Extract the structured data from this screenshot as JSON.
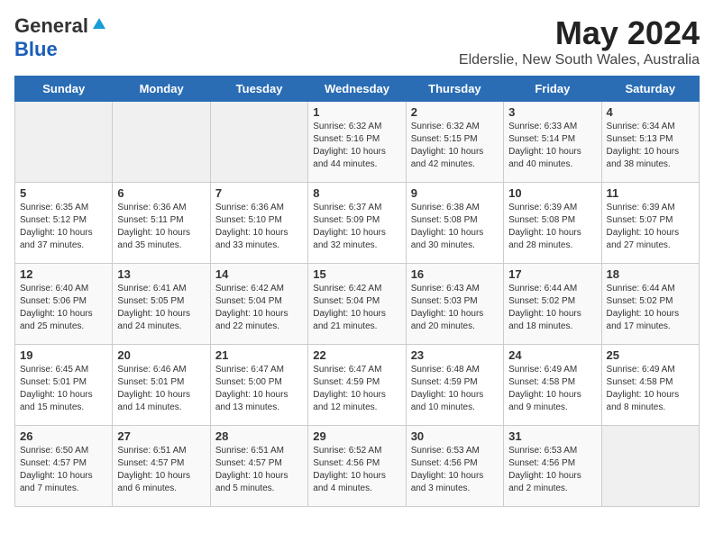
{
  "header": {
    "logo_general": "General",
    "logo_blue": "Blue",
    "month_title": "May 2024",
    "location": "Elderslie, New South Wales, Australia"
  },
  "days_of_week": [
    "Sunday",
    "Monday",
    "Tuesday",
    "Wednesday",
    "Thursday",
    "Friday",
    "Saturday"
  ],
  "weeks": [
    {
      "days": [
        {
          "number": "",
          "info": ""
        },
        {
          "number": "",
          "info": ""
        },
        {
          "number": "",
          "info": ""
        },
        {
          "number": "1",
          "info": "Sunrise: 6:32 AM\nSunset: 5:16 PM\nDaylight: 10 hours\nand 44 minutes."
        },
        {
          "number": "2",
          "info": "Sunrise: 6:32 AM\nSunset: 5:15 PM\nDaylight: 10 hours\nand 42 minutes."
        },
        {
          "number": "3",
          "info": "Sunrise: 6:33 AM\nSunset: 5:14 PM\nDaylight: 10 hours\nand 40 minutes."
        },
        {
          "number": "4",
          "info": "Sunrise: 6:34 AM\nSunset: 5:13 PM\nDaylight: 10 hours\nand 38 minutes."
        }
      ]
    },
    {
      "days": [
        {
          "number": "5",
          "info": "Sunrise: 6:35 AM\nSunset: 5:12 PM\nDaylight: 10 hours\nand 37 minutes."
        },
        {
          "number": "6",
          "info": "Sunrise: 6:36 AM\nSunset: 5:11 PM\nDaylight: 10 hours\nand 35 minutes."
        },
        {
          "number": "7",
          "info": "Sunrise: 6:36 AM\nSunset: 5:10 PM\nDaylight: 10 hours\nand 33 minutes."
        },
        {
          "number": "8",
          "info": "Sunrise: 6:37 AM\nSunset: 5:09 PM\nDaylight: 10 hours\nand 32 minutes."
        },
        {
          "number": "9",
          "info": "Sunrise: 6:38 AM\nSunset: 5:08 PM\nDaylight: 10 hours\nand 30 minutes."
        },
        {
          "number": "10",
          "info": "Sunrise: 6:39 AM\nSunset: 5:08 PM\nDaylight: 10 hours\nand 28 minutes."
        },
        {
          "number": "11",
          "info": "Sunrise: 6:39 AM\nSunset: 5:07 PM\nDaylight: 10 hours\nand 27 minutes."
        }
      ]
    },
    {
      "days": [
        {
          "number": "12",
          "info": "Sunrise: 6:40 AM\nSunset: 5:06 PM\nDaylight: 10 hours\nand 25 minutes."
        },
        {
          "number": "13",
          "info": "Sunrise: 6:41 AM\nSunset: 5:05 PM\nDaylight: 10 hours\nand 24 minutes."
        },
        {
          "number": "14",
          "info": "Sunrise: 6:42 AM\nSunset: 5:04 PM\nDaylight: 10 hours\nand 22 minutes."
        },
        {
          "number": "15",
          "info": "Sunrise: 6:42 AM\nSunset: 5:04 PM\nDaylight: 10 hours\nand 21 minutes."
        },
        {
          "number": "16",
          "info": "Sunrise: 6:43 AM\nSunset: 5:03 PM\nDaylight: 10 hours\nand 20 minutes."
        },
        {
          "number": "17",
          "info": "Sunrise: 6:44 AM\nSunset: 5:02 PM\nDaylight: 10 hours\nand 18 minutes."
        },
        {
          "number": "18",
          "info": "Sunrise: 6:44 AM\nSunset: 5:02 PM\nDaylight: 10 hours\nand 17 minutes."
        }
      ]
    },
    {
      "days": [
        {
          "number": "19",
          "info": "Sunrise: 6:45 AM\nSunset: 5:01 PM\nDaylight: 10 hours\nand 15 minutes."
        },
        {
          "number": "20",
          "info": "Sunrise: 6:46 AM\nSunset: 5:01 PM\nDaylight: 10 hours\nand 14 minutes."
        },
        {
          "number": "21",
          "info": "Sunrise: 6:47 AM\nSunset: 5:00 PM\nDaylight: 10 hours\nand 13 minutes."
        },
        {
          "number": "22",
          "info": "Sunrise: 6:47 AM\nSunset: 4:59 PM\nDaylight: 10 hours\nand 12 minutes."
        },
        {
          "number": "23",
          "info": "Sunrise: 6:48 AM\nSunset: 4:59 PM\nDaylight: 10 hours\nand 10 minutes."
        },
        {
          "number": "24",
          "info": "Sunrise: 6:49 AM\nSunset: 4:58 PM\nDaylight: 10 hours\nand 9 minutes."
        },
        {
          "number": "25",
          "info": "Sunrise: 6:49 AM\nSunset: 4:58 PM\nDaylight: 10 hours\nand 8 minutes."
        }
      ]
    },
    {
      "days": [
        {
          "number": "26",
          "info": "Sunrise: 6:50 AM\nSunset: 4:57 PM\nDaylight: 10 hours\nand 7 minutes."
        },
        {
          "number": "27",
          "info": "Sunrise: 6:51 AM\nSunset: 4:57 PM\nDaylight: 10 hours\nand 6 minutes."
        },
        {
          "number": "28",
          "info": "Sunrise: 6:51 AM\nSunset: 4:57 PM\nDaylight: 10 hours\nand 5 minutes."
        },
        {
          "number": "29",
          "info": "Sunrise: 6:52 AM\nSunset: 4:56 PM\nDaylight: 10 hours\nand 4 minutes."
        },
        {
          "number": "30",
          "info": "Sunrise: 6:53 AM\nSunset: 4:56 PM\nDaylight: 10 hours\nand 3 minutes."
        },
        {
          "number": "31",
          "info": "Sunrise: 6:53 AM\nSunset: 4:56 PM\nDaylight: 10 hours\nand 2 minutes."
        },
        {
          "number": "",
          "info": ""
        }
      ]
    }
  ]
}
